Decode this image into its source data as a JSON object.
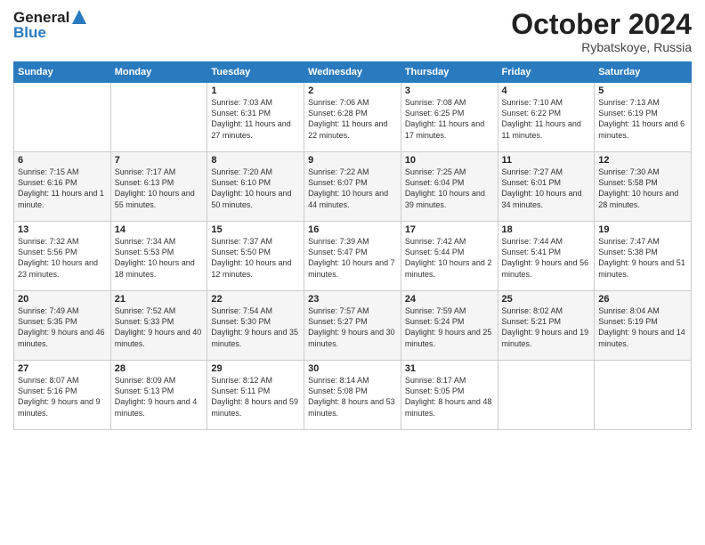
{
  "header": {
    "logo_line1": "General",
    "logo_line2": "Blue",
    "month_title": "October 2024",
    "location": "Rybatskoye, Russia"
  },
  "weekdays": [
    "Sunday",
    "Monday",
    "Tuesday",
    "Wednesday",
    "Thursday",
    "Friday",
    "Saturday"
  ],
  "weeks": [
    [
      {
        "day": "",
        "sunrise": "",
        "sunset": "",
        "daylight": ""
      },
      {
        "day": "",
        "sunrise": "",
        "sunset": "",
        "daylight": ""
      },
      {
        "day": "1",
        "sunrise": "Sunrise: 7:03 AM",
        "sunset": "Sunset: 6:31 PM",
        "daylight": "Daylight: 11 hours and 27 minutes."
      },
      {
        "day": "2",
        "sunrise": "Sunrise: 7:06 AM",
        "sunset": "Sunset: 6:28 PM",
        "daylight": "Daylight: 11 hours and 22 minutes."
      },
      {
        "day": "3",
        "sunrise": "Sunrise: 7:08 AM",
        "sunset": "Sunset: 6:25 PM",
        "daylight": "Daylight: 11 hours and 17 minutes."
      },
      {
        "day": "4",
        "sunrise": "Sunrise: 7:10 AM",
        "sunset": "Sunset: 6:22 PM",
        "daylight": "Daylight: 11 hours and 11 minutes."
      },
      {
        "day": "5",
        "sunrise": "Sunrise: 7:13 AM",
        "sunset": "Sunset: 6:19 PM",
        "daylight": "Daylight: 11 hours and 6 minutes."
      }
    ],
    [
      {
        "day": "6",
        "sunrise": "Sunrise: 7:15 AM",
        "sunset": "Sunset: 6:16 PM",
        "daylight": "Daylight: 11 hours and 1 minute."
      },
      {
        "day": "7",
        "sunrise": "Sunrise: 7:17 AM",
        "sunset": "Sunset: 6:13 PM",
        "daylight": "Daylight: 10 hours and 55 minutes."
      },
      {
        "day": "8",
        "sunrise": "Sunrise: 7:20 AM",
        "sunset": "Sunset: 6:10 PM",
        "daylight": "Daylight: 10 hours and 50 minutes."
      },
      {
        "day": "9",
        "sunrise": "Sunrise: 7:22 AM",
        "sunset": "Sunset: 6:07 PM",
        "daylight": "Daylight: 10 hours and 44 minutes."
      },
      {
        "day": "10",
        "sunrise": "Sunrise: 7:25 AM",
        "sunset": "Sunset: 6:04 PM",
        "daylight": "Daylight: 10 hours and 39 minutes."
      },
      {
        "day": "11",
        "sunrise": "Sunrise: 7:27 AM",
        "sunset": "Sunset: 6:01 PM",
        "daylight": "Daylight: 10 hours and 34 minutes."
      },
      {
        "day": "12",
        "sunrise": "Sunrise: 7:30 AM",
        "sunset": "Sunset: 5:58 PM",
        "daylight": "Daylight: 10 hours and 28 minutes."
      }
    ],
    [
      {
        "day": "13",
        "sunrise": "Sunrise: 7:32 AM",
        "sunset": "Sunset: 5:56 PM",
        "daylight": "Daylight: 10 hours and 23 minutes."
      },
      {
        "day": "14",
        "sunrise": "Sunrise: 7:34 AM",
        "sunset": "Sunset: 5:53 PM",
        "daylight": "Daylight: 10 hours and 18 minutes."
      },
      {
        "day": "15",
        "sunrise": "Sunrise: 7:37 AM",
        "sunset": "Sunset: 5:50 PM",
        "daylight": "Daylight: 10 hours and 12 minutes."
      },
      {
        "day": "16",
        "sunrise": "Sunrise: 7:39 AM",
        "sunset": "Sunset: 5:47 PM",
        "daylight": "Daylight: 10 hours and 7 minutes."
      },
      {
        "day": "17",
        "sunrise": "Sunrise: 7:42 AM",
        "sunset": "Sunset: 5:44 PM",
        "daylight": "Daylight: 10 hours and 2 minutes."
      },
      {
        "day": "18",
        "sunrise": "Sunrise: 7:44 AM",
        "sunset": "Sunset: 5:41 PM",
        "daylight": "Daylight: 9 hours and 56 minutes."
      },
      {
        "day": "19",
        "sunrise": "Sunrise: 7:47 AM",
        "sunset": "Sunset: 5:38 PM",
        "daylight": "Daylight: 9 hours and 51 minutes."
      }
    ],
    [
      {
        "day": "20",
        "sunrise": "Sunrise: 7:49 AM",
        "sunset": "Sunset: 5:35 PM",
        "daylight": "Daylight: 9 hours and 46 minutes."
      },
      {
        "day": "21",
        "sunrise": "Sunrise: 7:52 AM",
        "sunset": "Sunset: 5:33 PM",
        "daylight": "Daylight: 9 hours and 40 minutes."
      },
      {
        "day": "22",
        "sunrise": "Sunrise: 7:54 AM",
        "sunset": "Sunset: 5:30 PM",
        "daylight": "Daylight: 9 hours and 35 minutes."
      },
      {
        "day": "23",
        "sunrise": "Sunrise: 7:57 AM",
        "sunset": "Sunset: 5:27 PM",
        "daylight": "Daylight: 9 hours and 30 minutes."
      },
      {
        "day": "24",
        "sunrise": "Sunrise: 7:59 AM",
        "sunset": "Sunset: 5:24 PM",
        "daylight": "Daylight: 9 hours and 25 minutes."
      },
      {
        "day": "25",
        "sunrise": "Sunrise: 8:02 AM",
        "sunset": "Sunset: 5:21 PM",
        "daylight": "Daylight: 9 hours and 19 minutes."
      },
      {
        "day": "26",
        "sunrise": "Sunrise: 8:04 AM",
        "sunset": "Sunset: 5:19 PM",
        "daylight": "Daylight: 9 hours and 14 minutes."
      }
    ],
    [
      {
        "day": "27",
        "sunrise": "Sunrise: 8:07 AM",
        "sunset": "Sunset: 5:16 PM",
        "daylight": "Daylight: 9 hours and 9 minutes."
      },
      {
        "day": "28",
        "sunrise": "Sunrise: 8:09 AM",
        "sunset": "Sunset: 5:13 PM",
        "daylight": "Daylight: 9 hours and 4 minutes."
      },
      {
        "day": "29",
        "sunrise": "Sunrise: 8:12 AM",
        "sunset": "Sunset: 5:11 PM",
        "daylight": "Daylight: 8 hours and 59 minutes."
      },
      {
        "day": "30",
        "sunrise": "Sunrise: 8:14 AM",
        "sunset": "Sunset: 5:08 PM",
        "daylight": "Daylight: 8 hours and 53 minutes."
      },
      {
        "day": "31",
        "sunrise": "Sunrise: 8:17 AM",
        "sunset": "Sunset: 5:05 PM",
        "daylight": "Daylight: 8 hours and 48 minutes."
      },
      {
        "day": "",
        "sunrise": "",
        "sunset": "",
        "daylight": ""
      },
      {
        "day": "",
        "sunrise": "",
        "sunset": "",
        "daylight": ""
      }
    ]
  ]
}
